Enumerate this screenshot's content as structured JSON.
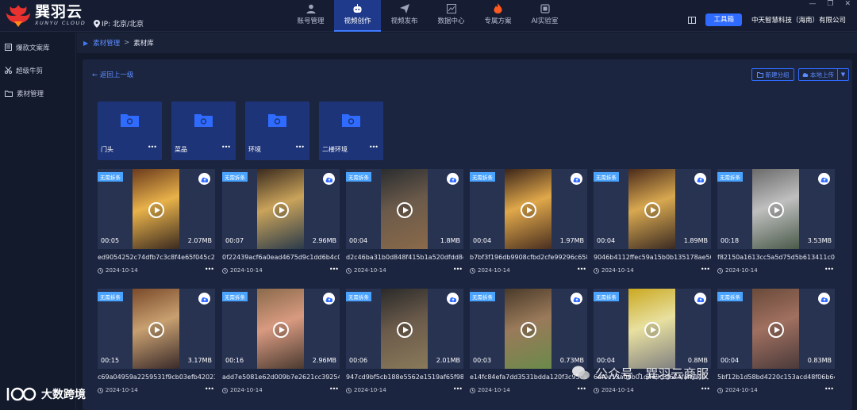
{
  "app": {
    "name_cn": "巽羽云",
    "name_en": "XUNYU CLOUD",
    "ip_text": "IP: 北京/北京"
  },
  "nav": [
    {
      "label": "账号管理",
      "icon": "user-icon"
    },
    {
      "label": "视频创作",
      "icon": "robot-icon"
    },
    {
      "label": "视频发布",
      "icon": "send-icon"
    },
    {
      "label": "数据中心",
      "icon": "chart-icon"
    },
    {
      "label": "专属方案",
      "icon": "fire-icon"
    },
    {
      "label": "AI实验室",
      "icon": "ai-chip-icon"
    }
  ],
  "top_right": {
    "tool_button": "工具箱",
    "company": "中天智慧科技（海南）有限公司"
  },
  "sidebar": [
    {
      "label": "爆款文案库",
      "icon": "library-icon"
    },
    {
      "label": "超级牛剪",
      "icon": "scissors-icon"
    },
    {
      "label": "素材管理",
      "icon": "folder-icon"
    }
  ],
  "breadcrumb": {
    "parent": "素材管理",
    "separator": ">",
    "current": "素材库"
  },
  "toolbar": {
    "back": "← 返回上一级",
    "new_group": "新建分组",
    "local_upload": "本地上传"
  },
  "folders": [
    {
      "name": "门头",
      "more": "•••"
    },
    {
      "name": "菜品",
      "more": "•••"
    },
    {
      "name": "环境",
      "more": "•••"
    },
    {
      "name": "二楼环境",
      "more": "•••"
    }
  ],
  "tag_label": "无需拆条",
  "more_label": "•••",
  "videos": [
    {
      "name": "ed9054252c74dfb7c3c8f4e65f045c2a",
      "duration": "00:05",
      "size": "2.07MB",
      "date": "2024-10-14"
    },
    {
      "name": "0f22439acf6a0ead4675d9c1dd6b4c0e",
      "duration": "00:07",
      "size": "2.96MB",
      "date": "2024-10-14"
    },
    {
      "name": "d2c46ba31b0d848f415b1a520dfdd8ca",
      "duration": "00:04",
      "size": "1.8MB",
      "date": "2024-10-14"
    },
    {
      "name": "b7bf3f196db9908cfbd2cfe99296c658",
      "duration": "00:04",
      "size": "1.97MB",
      "date": "2024-10-14"
    },
    {
      "name": "9046b4112ffec59a15b0b135178ae509",
      "duration": "00:04",
      "size": "1.89MB",
      "date": "2024-10-14"
    },
    {
      "name": "f82150a1613cc5a5d75d5b613411c0de",
      "duration": "00:18",
      "size": "3.53MB",
      "date": "2024-10-14"
    },
    {
      "name": "c69a04959a2259531f9cb03efb42023c",
      "duration": "00:15",
      "size": "3.17MB",
      "date": "2024-10-14"
    },
    {
      "name": "add7e5081e62d009b7e2621cc3925470",
      "duration": "00:16",
      "size": "2.96MB",
      "date": "2024-10-14"
    },
    {
      "name": "947cd9bf5cb188e5562e1519af65f989",
      "duration": "00:06",
      "size": "2.01MB",
      "date": "2024-10-14"
    },
    {
      "name": "e14fc84efa7dd3531bdda120f3c95ca8",
      "duration": "00:03",
      "size": "0.73MB",
      "date": "2024-10-14"
    },
    {
      "name": "6df0c13a06b01d4e9c3f674fafb149",
      "duration": "00:04",
      "size": "0.8MB",
      "date": "2024-10-14"
    },
    {
      "name": "5bf12b1d58bd4220c153acd48f06b649",
      "duration": "00:04",
      "size": "0.83MB",
      "date": "2024-10-14"
    }
  ],
  "watermarks": {
    "left": "大数跨境",
    "right": "公众号 · 巽羽云商服"
  }
}
